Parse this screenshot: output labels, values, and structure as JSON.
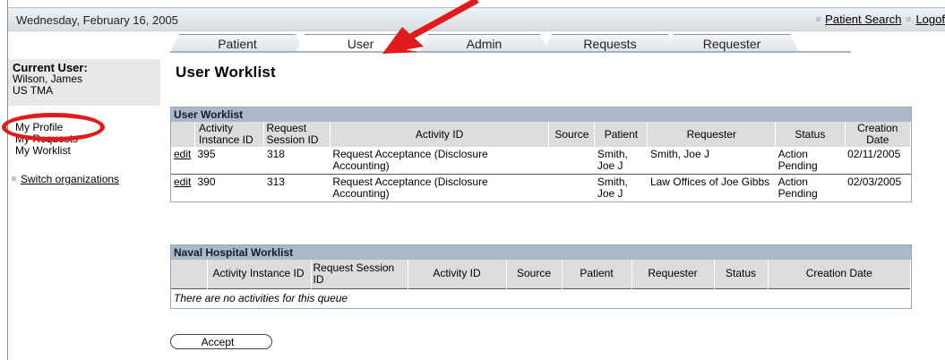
{
  "header": {
    "date": "Wednesday, February 16, 2005",
    "links": [
      "Patient Search",
      "Logof"
    ]
  },
  "tabs": [
    {
      "label": "Patient",
      "active": false
    },
    {
      "label": "User",
      "active": true
    },
    {
      "label": "Admin",
      "active": false
    },
    {
      "label": "Requests",
      "active": false
    },
    {
      "label": "Requester",
      "active": false
    }
  ],
  "sidebar": {
    "current_user_label": "Current User:",
    "user_name": "Wilson, James",
    "org": "US TMA",
    "nav": [
      "My Profile",
      "My Requests",
      "My Worklist"
    ],
    "switch_org": "Switch organizations"
  },
  "page_title": "User Worklist",
  "user_worklist": {
    "title": "User Worklist",
    "columns": [
      "Activity Instance ID",
      "Request Session ID",
      "Activity ID",
      "Source",
      "Patient",
      "Requester",
      "Status",
      "Creation Date"
    ],
    "rows": [
      {
        "action": "edit",
        "instance": "395",
        "session": "318",
        "activity": "Request Acceptance (Disclosure Accounting)",
        "source": "",
        "patient": "Smith, Joe J",
        "requester": "Smith, Joe J",
        "status": "Action Pending",
        "date": "02/11/2005"
      },
      {
        "action": "edit",
        "instance": "390",
        "session": "313",
        "activity": "Request Acceptance (Disclosure Accounting)",
        "source": "",
        "patient": "Smith, Joe J",
        "requester": "Law Offices of Joe Gibbs",
        "status": "Action Pending",
        "date": "02/03/2005"
      }
    ]
  },
  "naval_worklist": {
    "title": "Naval Hospital Worklist",
    "columns": [
      "Activity Instance ID",
      "Request Session ID",
      "Activity ID",
      "Source",
      "Patient",
      "Requester",
      "Status",
      "Creation Date"
    ],
    "empty_text": "There are no activities for this queue"
  },
  "accept_label": "Accept",
  "colors": {
    "accent_red": "#e11b1b",
    "table_header": "#a9b9c8"
  }
}
